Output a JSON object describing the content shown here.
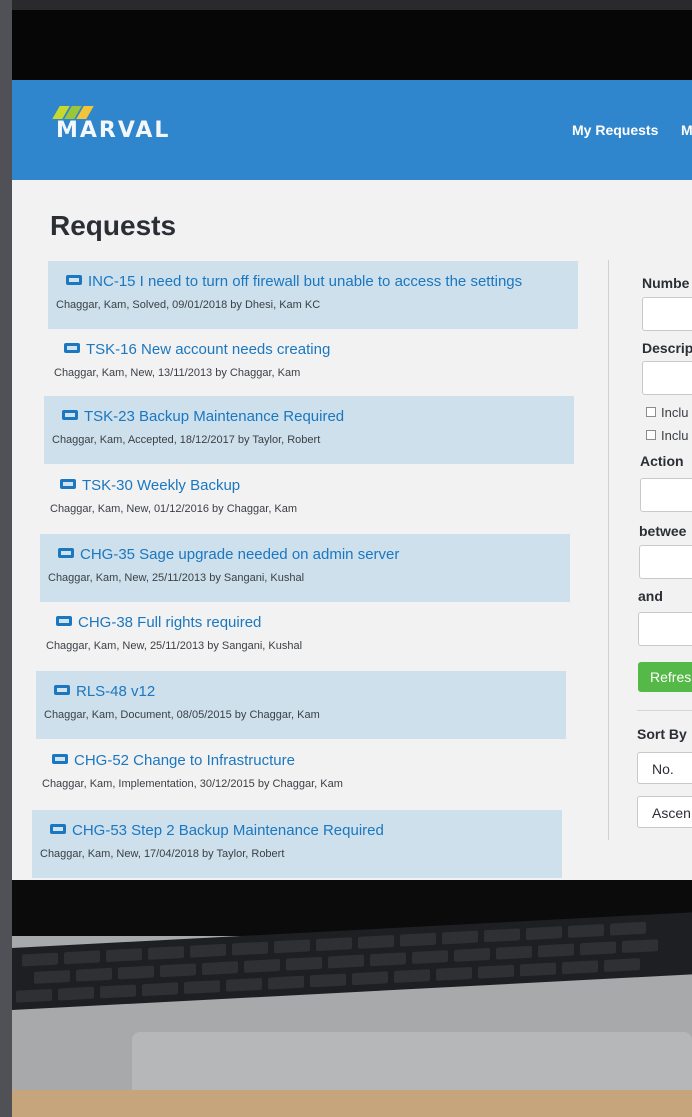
{
  "app": {
    "logo_text": "MARVAL",
    "nav": [
      "My Requests",
      "M"
    ]
  },
  "page": {
    "title": "Requests"
  },
  "requests": [
    {
      "title": "INC-15 I need to turn off firewall but unable to access the settings",
      "meta": "Chaggar, Kam,  Solved,  09/01/2018 by Dhesi, Kam KC"
    },
    {
      "title": "TSK-16 New account needs creating",
      "meta": "Chaggar, Kam,  New,  13/11/2013 by Chaggar, Kam"
    },
    {
      "title": "TSK-23 Backup Maintenance Required",
      "meta": "Chaggar, Kam,  Accepted,  18/12/2017 by Taylor, Robert"
    },
    {
      "title": "TSK-30 Weekly Backup",
      "meta": "Chaggar, Kam,  New,  01/12/2016 by Chaggar, Kam"
    },
    {
      "title": "CHG-35 Sage upgrade needed on admin server",
      "meta": "Chaggar, Kam,  New,  25/11/2013 by Sangani, Kushal"
    },
    {
      "title": "CHG-38 Full rights required",
      "meta": "Chaggar, Kam,  New,  25/11/2013 by Sangani, Kushal"
    },
    {
      "title": "RLS-48 v12",
      "meta": "Chaggar, Kam,  Document,  08/05/2015 by Chaggar, Kam"
    },
    {
      "title": "CHG-52 Change to Infrastructure",
      "meta": "Chaggar, Kam,  Implementation,  30/12/2015 by Chaggar, Kam"
    },
    {
      "title": "CHG-53 Step 2 Backup Maintenance Required",
      "meta": "Chaggar, Kam,  New,  17/04/2018 by Taylor, Robert"
    }
  ],
  "filters": {
    "number_label": "Numbe",
    "description_label": "Descrip",
    "include_1": "Inclu",
    "include_2": "Inclu",
    "action_label": "Action",
    "between_label": "betwee",
    "and_label": "and",
    "refresh_label": "Refres",
    "sort_by_label": "Sort By",
    "sort_field_value": "No.",
    "sort_order_value": "Ascen"
  },
  "colors": {
    "topbar": "#2f86cc",
    "link": "#1b77c0",
    "row_shade": "#cde0ec",
    "refresh": "#55b947"
  }
}
